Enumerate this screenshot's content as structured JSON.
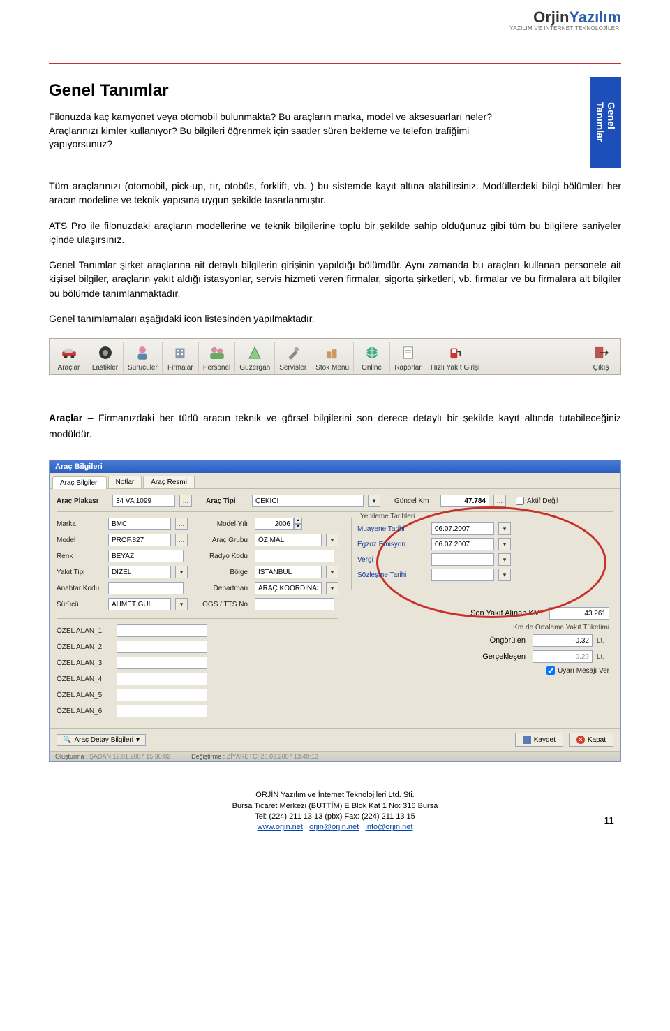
{
  "logo": {
    "brand1": "Orjin",
    "brand2": "Yazılım",
    "sub": "YAZILIM VE INTERNET TEKNOLOJİLERİ"
  },
  "side_tab": "Genel\nTanımlar",
  "title": "Genel Tanımlar",
  "intro": "Filonuzda kaç kamyonet veya otomobil bulunmakta? Bu araçların marka, model ve aksesuarları neler? Araçlarınızı kimler kullanıyor? Bu bilgileri öğrenmek için saatler süren bekleme ve telefon trafiğimi yapıyorsunuz?",
  "para1": "Tüm araçlarınızı (otomobil, pick-up, tır, otobüs, forklift, vb. ) bu sistemde kayıt altına alabilirsiniz. Modüllerdeki bilgi bölümleri her aracın modeline ve teknik yapısına uygun şekilde tasarlanmıştır.",
  "para2": "ATS Pro ile filonuzdaki araçların modellerine ve teknik bilgilerine toplu bir şekilde sahip olduğunuz gibi tüm bu bilgilere saniyeler içinde ulaşırsınız.",
  "para3": "Genel Tanımlar şirket araçlarına ait detaylı bilgilerin girişinin yapıldığı bölümdür. Aynı zamanda bu araçları kullanan personele ait kişisel bilgiler, araçların yakıt aldığı istasyonlar, servis hizmeti veren firmalar, sigorta şirketleri, vb. firmalar ve bu firmalara ait bilgiler bu bölümde tanımlanmaktadır.",
  "para4": "Genel tanımlamaları aşağıdaki icon listesinden yapılmaktadır.",
  "toolbar": {
    "items": [
      {
        "label": "Araçlar"
      },
      {
        "label": "Lastikler"
      },
      {
        "label": "Sürücüler"
      },
      {
        "label": "Firmalar"
      },
      {
        "label": "Personel"
      },
      {
        "label": "Güzergah"
      },
      {
        "label": "Servisler"
      },
      {
        "label": "Stok Menü"
      },
      {
        "label": "Online"
      },
      {
        "label": "Raporlar"
      },
      {
        "label": "Hızlı Yakıt Girişi"
      },
      {
        "label": "Çıkış"
      }
    ]
  },
  "section": {
    "head": "Araçlar",
    "tail": " – Firmanızdaki her türlü aracın teknik ve görsel bilgilerini son derece detaylı bir şekilde kayıt altında tutabileceğiniz modüldür."
  },
  "win": {
    "title": "Araç Bilgileri",
    "tabs": [
      "Araç Bilgileri",
      "Notlar",
      "Araç Resmi"
    ],
    "top": {
      "plate_lbl": "Araç Plakası",
      "plate": "34 VA 1099",
      "type_lbl": "Araç Tipi",
      "type": "ÇEKİCİ",
      "km_lbl": "Güncel Km",
      "km": "47.784",
      "inactive": "Aktif Değil"
    },
    "left": {
      "marka_lbl": "Marka",
      "marka": "BMC",
      "model_lbl": "Model",
      "model": "PROF.827",
      "renk_lbl": "Renk",
      "renk": "BEYAZ",
      "yakit_lbl": "Yakıt Tipi",
      "yakit": "DİZEL",
      "anahtar_lbl": "Anahtar Kodu",
      "anahtar": "",
      "surucu_lbl": "Sürücü",
      "surucu": "AHMET GÜL",
      "myil_lbl": "Model Yılı",
      "myil": "2006",
      "grup_lbl": "Araç Grubu",
      "grup": "ÖZ MAL",
      "radyo_lbl": "Radyo Kodu",
      "radyo": "",
      "bolge_lbl": "Bölge",
      "bolge": "İSTANBUL",
      "dept_lbl": "Departman",
      "dept": "ARAÇ KOORDİNASYON",
      "ogs_lbl": "OGS / TTS No",
      "ogs": ""
    },
    "dates": {
      "legend": "Yenileme Tarihleri",
      "muayene_lbl": "Muayene Tarihi",
      "muayene": "06.07.2007",
      "egzoz_lbl": "Egzoz Emisyon",
      "egzoz": "06.07.2007",
      "vergi_lbl": "Vergi",
      "vergi": "",
      "sozlesme_lbl": "Sözleşme Tarihi",
      "sozlesme": ""
    },
    "ozel": {
      "a1": "ÖZEL ALAN_1",
      "a2": "ÖZEL ALAN_2",
      "a3": "ÖZEL ALAN_3",
      "a4": "ÖZEL ALAN_4",
      "a5": "ÖZEL ALAN_5",
      "a6": "ÖZEL ALAN_6"
    },
    "fuel": {
      "last_km_lbl": "Son Yakıt Alınan KM.",
      "last_km": "43.261",
      "avg_lbl": "Km.de Ortalama Yakıt Tüketimi",
      "ong_lbl": "Öngörülen",
      "ong": "0,32",
      "ger_lbl": "Gerçekleşen",
      "ger": "0,29",
      "unit": "Lt.",
      "warn": "Uyarı Mesajı Ver"
    },
    "footer": {
      "detail": "Araç Detay Bilgileri",
      "save": "Kaydet",
      "close": "Kapat"
    },
    "status": {
      "created": "Oluşturma :",
      "created_val": "ŞADAN 12.01.2007 15:36:02",
      "modified": "Değiştirme :",
      "modified_val": "ZİYARETÇİ 28.03.2007 13:49:13"
    }
  },
  "footer": {
    "l1": "ORJİN Yazılım ve İnternet Teknolojileri Ltd. Sti.",
    "l2": "Bursa Ticaret Merkezi (BUTTİM) E Blok Kat 1 No: 316 Bursa",
    "l3": "Tel: (224) 211 13 13 (pbx) Fax: (224) 211 13 15",
    "link1": "www.orjin.net",
    "link2": "orjin@orjin.net",
    "link3": "info@orjin.net",
    "page": "11"
  }
}
